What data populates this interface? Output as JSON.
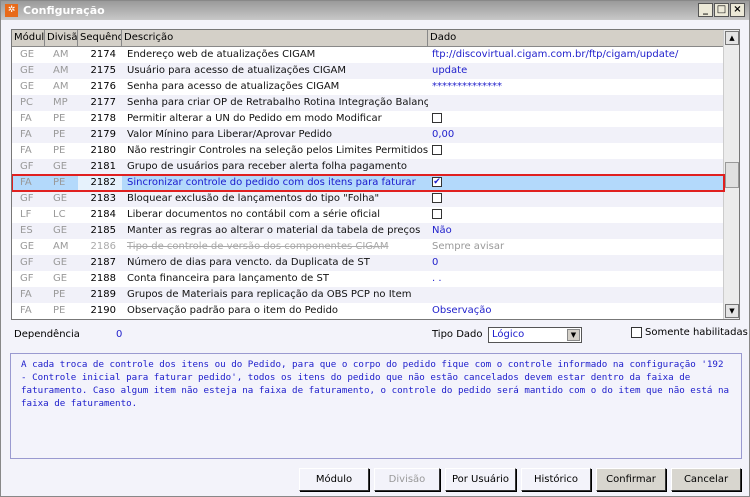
{
  "window": {
    "title": "Configuração",
    "minimize": "_",
    "maximize": "□",
    "close": "×"
  },
  "columns": [
    "Módulo",
    "Divisão",
    "Sequência",
    "Descrição",
    "Dado"
  ],
  "rows": [
    {
      "modulo": "GE",
      "divisao": "AM",
      "seq": "2174",
      "desc": "Endereço web de atualizações CIGAM",
      "dado": "ftp://discovirtual.cigam.com.br/ftp/cigam/update/"
    },
    {
      "modulo": "GE",
      "divisao": "AM",
      "seq": "2175",
      "desc": "Usuário para acesso de atualizações CIGAM",
      "dado": "update"
    },
    {
      "modulo": "GE",
      "divisao": "AM",
      "seq": "2176",
      "desc": "Senha para acesso de atualizações CIGAM",
      "dado": "**************"
    },
    {
      "modulo": "PC",
      "divisao": "MP",
      "seq": "2177",
      "desc": "Senha para criar OP de Retrabalho Rotina Integração Balança",
      "dado": ""
    },
    {
      "modulo": "FA",
      "divisao": "PE",
      "seq": "2178",
      "desc": "Permitir alterar a UN do Pedido em modo Modificar",
      "checkbox": false
    },
    {
      "modulo": "FA",
      "divisao": "PE",
      "seq": "2179",
      "desc": "Valor Mínino para Liberar/Aprovar Pedido",
      "dado": "0,00"
    },
    {
      "modulo": "FA",
      "divisao": "PE",
      "seq": "2180",
      "desc": "Não restringir Controles na seleção pelos Limites Permitidos",
      "checkbox": false
    },
    {
      "modulo": "GF",
      "divisao": "GE",
      "seq": "2181",
      "desc": "Grupo de usuários para receber alerta folha pagamento",
      "dado": ""
    },
    {
      "modulo": "FA",
      "divisao": "PE",
      "seq": "2182",
      "desc": "Sincronizar controle do pedido com dos itens para faturar",
      "checkbox": true,
      "selected": true
    },
    {
      "modulo": "GF",
      "divisao": "GE",
      "seq": "2183",
      "desc": "Bloquear exclusão de lançamentos do tipo \"Folha\"",
      "checkbox": false
    },
    {
      "modulo": "LF",
      "divisao": "LC",
      "seq": "2184",
      "desc": "Liberar documentos no contábil com a série oficial",
      "checkbox": false
    },
    {
      "modulo": "ES",
      "divisao": "GE",
      "seq": "2185",
      "desc": "Manter as regras ao alterar o material da tabela de preços",
      "dado": "Não"
    },
    {
      "modulo": "GE",
      "divisao": "AM",
      "seq": "2186",
      "desc": "Tipo de controle de versão dos componentes CIGAM",
      "dado": "Sempre avisar",
      "disabled": true
    },
    {
      "modulo": "GF",
      "divisao": "GE",
      "seq": "2187",
      "desc": "Número de dias para vencto. da Duplicata de ST",
      "dado": "0"
    },
    {
      "modulo": "GF",
      "divisao": "GE",
      "seq": "2188",
      "desc": "Conta financeira para lançamento de ST",
      "dado": " . ."
    },
    {
      "modulo": "FA",
      "divisao": "PE",
      "seq": "2189",
      "desc": "Grupos de Materiais para replicação da OBS PCP no Item",
      "dado": ""
    },
    {
      "modulo": "FA",
      "divisao": "PE",
      "seq": "2190",
      "desc": "Observação padrão para o item do Pedido",
      "dado": "Observação"
    }
  ],
  "dependencia": {
    "label": "Dependência",
    "value": "0"
  },
  "tipo_dado": {
    "label": "Tipo Dado",
    "value": "Lógico"
  },
  "somente_habilitadas": {
    "label": "Somente habilitadas",
    "checked": false
  },
  "description": "A cada troca de controle dos itens ou do Pedido, para que o corpo do pedido fique com o controle informado na configuração '192 - Controle inicial para faturar pedido', todos os itens do pedido que não estão cancelados devem estar dentro da faixa de faturamento. Caso algum item não esteja na faixa de faturamento, o controle do pedido será mantido com o do item que não está na faixa de faturamento.",
  "buttons": {
    "modulo": "Módulo",
    "divisao": "Divisão",
    "por_usuario": "Por Usuário",
    "historico": "Histórico",
    "confirmar": "Confirmar",
    "cancelar": "Cancelar"
  }
}
